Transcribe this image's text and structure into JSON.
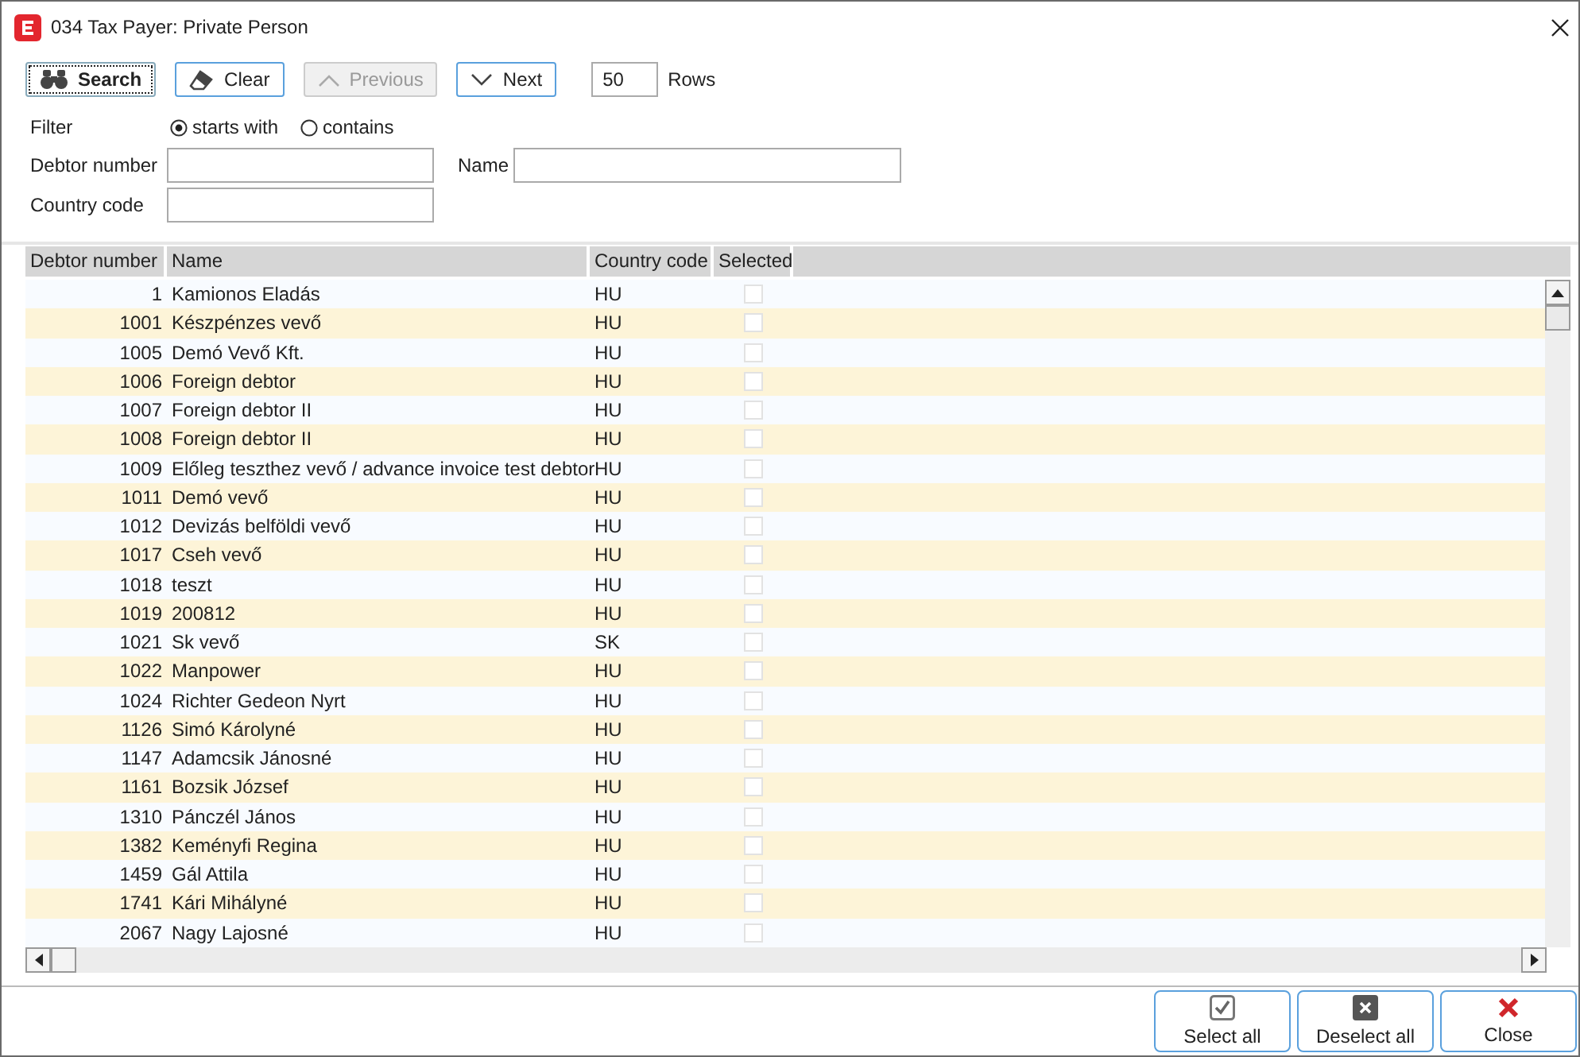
{
  "window": {
    "title": "034 Tax Payer: Private Person"
  },
  "toolbar": {
    "buttons": [
      {
        "kind": "search",
        "label": "Search",
        "disabled": false,
        "focused": true
      },
      {
        "kind": "clear",
        "label": "Clear",
        "disabled": false,
        "focused": false
      },
      {
        "kind": "previous",
        "label": "Previous",
        "disabled": true,
        "focused": false
      },
      {
        "kind": "next",
        "label": "Next",
        "disabled": false,
        "focused": false
      }
    ],
    "rows_value": "50",
    "rows_label": "Rows"
  },
  "filter": {
    "label": "Filter",
    "options": [
      {
        "label": "starts with",
        "selected": true
      },
      {
        "label": "contains",
        "selected": false
      }
    ]
  },
  "fields": [
    {
      "label": "Debtor number"
    },
    {
      "label": "Name"
    },
    {
      "label": "Country code"
    }
  ],
  "table": {
    "columns": [
      "Debtor number",
      "Name",
      "Country code",
      "Selected"
    ],
    "rows": [
      {
        "debtor_number": "1",
        "name": "Kamionos Eladás",
        "country_code": "HU",
        "selected": false
      },
      {
        "debtor_number": "1001",
        "name": "Készpénzes vevő",
        "country_code": "HU",
        "selected": false
      },
      {
        "debtor_number": "1005",
        "name": "Demó Vevő Kft.",
        "country_code": "HU",
        "selected": false
      },
      {
        "debtor_number": "1006",
        "name": "Foreign debtor",
        "country_code": "HU",
        "selected": false
      },
      {
        "debtor_number": "1007",
        "name": "Foreign debtor II",
        "country_code": "HU",
        "selected": false
      },
      {
        "debtor_number": "1008",
        "name": "Foreign debtor II",
        "country_code": "HU",
        "selected": false
      },
      {
        "debtor_number": "1009",
        "name": "Előleg teszthez vevő / advance invoice test debtor",
        "country_code": "HU",
        "selected": false
      },
      {
        "debtor_number": "1011",
        "name": "Demó vevő",
        "country_code": "HU",
        "selected": false
      },
      {
        "debtor_number": "1012",
        "name": "Devizás belföldi vevő",
        "country_code": "HU",
        "selected": false
      },
      {
        "debtor_number": "1017",
        "name": "Cseh vevő",
        "country_code": "HU",
        "selected": false
      },
      {
        "debtor_number": "1018",
        "name": "teszt",
        "country_code": "HU",
        "selected": false
      },
      {
        "debtor_number": "1019",
        "name": "200812",
        "country_code": "HU",
        "selected": false
      },
      {
        "debtor_number": "1021",
        "name": "Sk vevő",
        "country_code": "SK",
        "selected": false
      },
      {
        "debtor_number": "1022",
        "name": "Manpower",
        "country_code": "HU",
        "selected": false
      },
      {
        "debtor_number": "1024",
        "name": "Richter Gedeon Nyrt",
        "country_code": "HU",
        "selected": false
      },
      {
        "debtor_number": "1126",
        "name": "Simó Károlyné",
        "country_code": "HU",
        "selected": false
      },
      {
        "debtor_number": "1147",
        "name": "Adamcsik Jánosné",
        "country_code": "HU",
        "selected": false
      },
      {
        "debtor_number": "1161",
        "name": "Bozsik József",
        "country_code": "HU",
        "selected": false
      },
      {
        "debtor_number": "1310",
        "name": "Pánczél János",
        "country_code": "HU",
        "selected": false
      },
      {
        "debtor_number": "1382",
        "name": "Keményfi Regina",
        "country_code": "HU",
        "selected": false
      },
      {
        "debtor_number": "1459",
        "name": "Gál Attila",
        "country_code": "HU",
        "selected": false
      },
      {
        "debtor_number": "1741",
        "name": "Kári Mihályné",
        "country_code": "HU",
        "selected": false
      },
      {
        "debtor_number": "2067",
        "name": "Nagy Lajosné",
        "country_code": "HU",
        "selected": false
      }
    ]
  },
  "footer": {
    "buttons": [
      {
        "kind": "select_all",
        "label": "Select all"
      },
      {
        "kind": "deselect_all",
        "label": "Deselect all"
      },
      {
        "kind": "close",
        "label": "Close"
      }
    ]
  }
}
